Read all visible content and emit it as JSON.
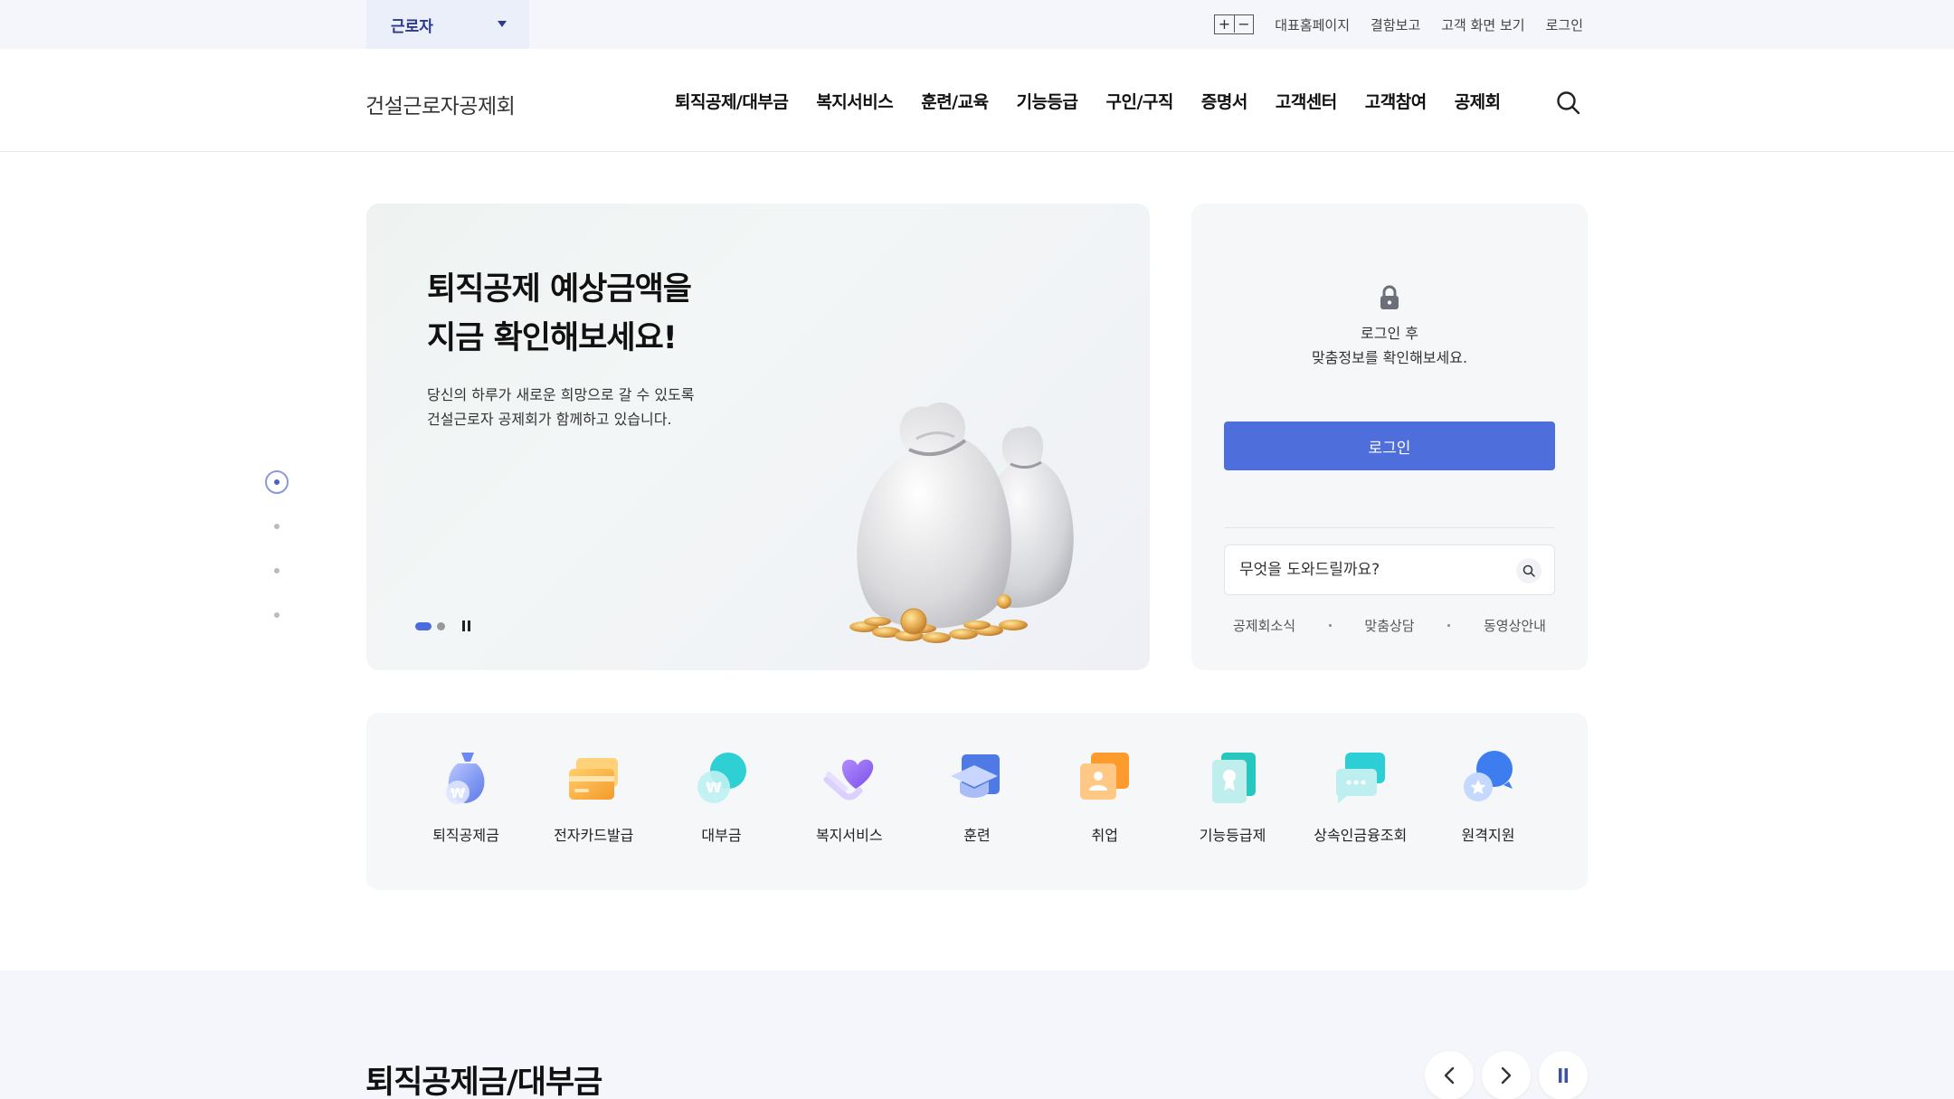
{
  "topbar": {
    "role": "근로자",
    "zoom_in": "+",
    "zoom_out": "−",
    "links": [
      "대표홈페이지",
      "결함보고",
      "고객 화면 보기",
      "로그인"
    ]
  },
  "header": {
    "logo": "건설근로자공제회",
    "nav": [
      "퇴직공제/대부금",
      "복지서비스",
      "훈련/교육",
      "기능등급",
      "구인/구직",
      "증명서",
      "고객센터",
      "고객참여",
      "공제회"
    ]
  },
  "hero": {
    "title_line1": "퇴직공제 예상금액을",
    "title_line2": "지금 확인해보세요!",
    "desc_line1": "당신의 하루가 새로운 희망으로 갈 수 있도록",
    "desc_line2": "건설근로자 공제회가 함께하고 있습니다."
  },
  "login": {
    "msg_line1": "로그인 후",
    "msg_line2": "맞춤정보를 확인해보세요.",
    "button": "로그인",
    "help_placeholder": "무엇을 도와드릴까요?",
    "quick_links": [
      "공제회소식",
      "맞춤상담",
      "동영상안내"
    ]
  },
  "quickmenu": {
    "items": [
      {
        "label": "퇴직공제금",
        "icon": "money-bag-icon"
      },
      {
        "label": "전자카드발급",
        "icon": "card-icon"
      },
      {
        "label": "대부금",
        "icon": "coin-icon"
      },
      {
        "label": "복지서비스",
        "icon": "heart-hand-icon"
      },
      {
        "label": "훈련",
        "icon": "graduation-cap-icon"
      },
      {
        "label": "취업",
        "icon": "id-card-icon"
      },
      {
        "label": "기능등급제",
        "icon": "certificate-icon"
      },
      {
        "label": "상속인금융조회",
        "icon": "chat-icon"
      },
      {
        "label": "원격지원",
        "icon": "support-chat-icon"
      }
    ]
  },
  "bottom": {
    "section_title": "퇴직공제금/대부금"
  },
  "colors": {
    "accent": "#4e6edb",
    "topbar_bg": "#f4f6fb",
    "panel_bg": "#f6f7f9"
  }
}
